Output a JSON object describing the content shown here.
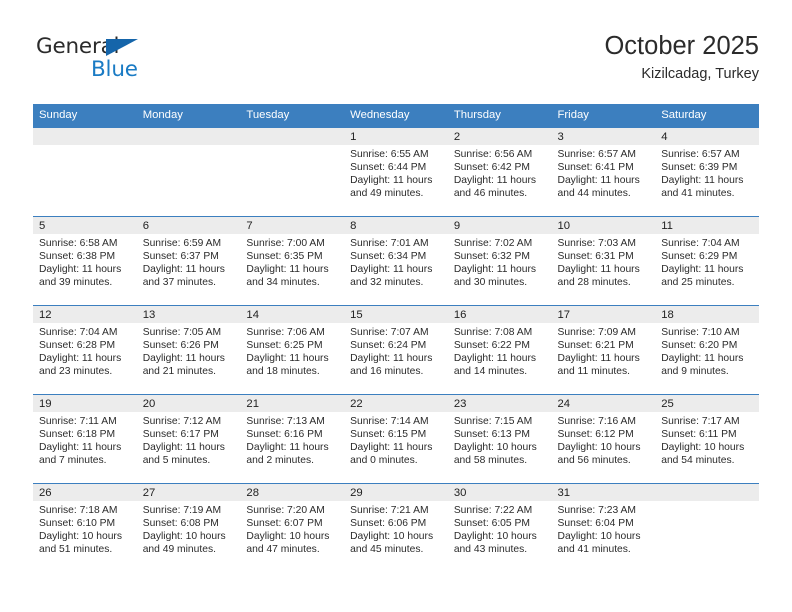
{
  "brand": {
    "name_part1": "General",
    "name_part2": "Blue",
    "logo_icon": "triangle-flag-icon"
  },
  "header": {
    "title": "October 2025",
    "subtitle": "Kizilcadag, Turkey"
  },
  "calendar": {
    "weekday_headers": [
      "Sunday",
      "Monday",
      "Tuesday",
      "Wednesday",
      "Thursday",
      "Friday",
      "Saturday"
    ],
    "accent_color": "#3c7fbf",
    "daynum_bar_color": "#ececec",
    "weeks": [
      [
        {
          "day": "",
          "sunrise": "",
          "sunset": "",
          "daylight_line1": "",
          "daylight_line2": ""
        },
        {
          "day": "",
          "sunrise": "",
          "sunset": "",
          "daylight_line1": "",
          "daylight_line2": ""
        },
        {
          "day": "",
          "sunrise": "",
          "sunset": "",
          "daylight_line1": "",
          "daylight_line2": ""
        },
        {
          "day": "1",
          "sunrise": "Sunrise: 6:55 AM",
          "sunset": "Sunset: 6:44 PM",
          "daylight_line1": "Daylight: 11 hours",
          "daylight_line2": "and 49 minutes."
        },
        {
          "day": "2",
          "sunrise": "Sunrise: 6:56 AM",
          "sunset": "Sunset: 6:42 PM",
          "daylight_line1": "Daylight: 11 hours",
          "daylight_line2": "and 46 minutes."
        },
        {
          "day": "3",
          "sunrise": "Sunrise: 6:57 AM",
          "sunset": "Sunset: 6:41 PM",
          "daylight_line1": "Daylight: 11 hours",
          "daylight_line2": "and 44 minutes."
        },
        {
          "day": "4",
          "sunrise": "Sunrise: 6:57 AM",
          "sunset": "Sunset: 6:39 PM",
          "daylight_line1": "Daylight: 11 hours",
          "daylight_line2": "and 41 minutes."
        }
      ],
      [
        {
          "day": "5",
          "sunrise": "Sunrise: 6:58 AM",
          "sunset": "Sunset: 6:38 PM",
          "daylight_line1": "Daylight: 11 hours",
          "daylight_line2": "and 39 minutes."
        },
        {
          "day": "6",
          "sunrise": "Sunrise: 6:59 AM",
          "sunset": "Sunset: 6:37 PM",
          "daylight_line1": "Daylight: 11 hours",
          "daylight_line2": "and 37 minutes."
        },
        {
          "day": "7",
          "sunrise": "Sunrise: 7:00 AM",
          "sunset": "Sunset: 6:35 PM",
          "daylight_line1": "Daylight: 11 hours",
          "daylight_line2": "and 34 minutes."
        },
        {
          "day": "8",
          "sunrise": "Sunrise: 7:01 AM",
          "sunset": "Sunset: 6:34 PM",
          "daylight_line1": "Daylight: 11 hours",
          "daylight_line2": "and 32 minutes."
        },
        {
          "day": "9",
          "sunrise": "Sunrise: 7:02 AM",
          "sunset": "Sunset: 6:32 PM",
          "daylight_line1": "Daylight: 11 hours",
          "daylight_line2": "and 30 minutes."
        },
        {
          "day": "10",
          "sunrise": "Sunrise: 7:03 AM",
          "sunset": "Sunset: 6:31 PM",
          "daylight_line1": "Daylight: 11 hours",
          "daylight_line2": "and 28 minutes."
        },
        {
          "day": "11",
          "sunrise": "Sunrise: 7:04 AM",
          "sunset": "Sunset: 6:29 PM",
          "daylight_line1": "Daylight: 11 hours",
          "daylight_line2": "and 25 minutes."
        }
      ],
      [
        {
          "day": "12",
          "sunrise": "Sunrise: 7:04 AM",
          "sunset": "Sunset: 6:28 PM",
          "daylight_line1": "Daylight: 11 hours",
          "daylight_line2": "and 23 minutes."
        },
        {
          "day": "13",
          "sunrise": "Sunrise: 7:05 AM",
          "sunset": "Sunset: 6:26 PM",
          "daylight_line1": "Daylight: 11 hours",
          "daylight_line2": "and 21 minutes."
        },
        {
          "day": "14",
          "sunrise": "Sunrise: 7:06 AM",
          "sunset": "Sunset: 6:25 PM",
          "daylight_line1": "Daylight: 11 hours",
          "daylight_line2": "and 18 minutes."
        },
        {
          "day": "15",
          "sunrise": "Sunrise: 7:07 AM",
          "sunset": "Sunset: 6:24 PM",
          "daylight_line1": "Daylight: 11 hours",
          "daylight_line2": "and 16 minutes."
        },
        {
          "day": "16",
          "sunrise": "Sunrise: 7:08 AM",
          "sunset": "Sunset: 6:22 PM",
          "daylight_line1": "Daylight: 11 hours",
          "daylight_line2": "and 14 minutes."
        },
        {
          "day": "17",
          "sunrise": "Sunrise: 7:09 AM",
          "sunset": "Sunset: 6:21 PM",
          "daylight_line1": "Daylight: 11 hours",
          "daylight_line2": "and 11 minutes."
        },
        {
          "day": "18",
          "sunrise": "Sunrise: 7:10 AM",
          "sunset": "Sunset: 6:20 PM",
          "daylight_line1": "Daylight: 11 hours",
          "daylight_line2": "and 9 minutes."
        }
      ],
      [
        {
          "day": "19",
          "sunrise": "Sunrise: 7:11 AM",
          "sunset": "Sunset: 6:18 PM",
          "daylight_line1": "Daylight: 11 hours",
          "daylight_line2": "and 7 minutes."
        },
        {
          "day": "20",
          "sunrise": "Sunrise: 7:12 AM",
          "sunset": "Sunset: 6:17 PM",
          "daylight_line1": "Daylight: 11 hours",
          "daylight_line2": "and 5 minutes."
        },
        {
          "day": "21",
          "sunrise": "Sunrise: 7:13 AM",
          "sunset": "Sunset: 6:16 PM",
          "daylight_line1": "Daylight: 11 hours",
          "daylight_line2": "and 2 minutes."
        },
        {
          "day": "22",
          "sunrise": "Sunrise: 7:14 AM",
          "sunset": "Sunset: 6:15 PM",
          "daylight_line1": "Daylight: 11 hours",
          "daylight_line2": "and 0 minutes."
        },
        {
          "day": "23",
          "sunrise": "Sunrise: 7:15 AM",
          "sunset": "Sunset: 6:13 PM",
          "daylight_line1": "Daylight: 10 hours",
          "daylight_line2": "and 58 minutes."
        },
        {
          "day": "24",
          "sunrise": "Sunrise: 7:16 AM",
          "sunset": "Sunset: 6:12 PM",
          "daylight_line1": "Daylight: 10 hours",
          "daylight_line2": "and 56 minutes."
        },
        {
          "day": "25",
          "sunrise": "Sunrise: 7:17 AM",
          "sunset": "Sunset: 6:11 PM",
          "daylight_line1": "Daylight: 10 hours",
          "daylight_line2": "and 54 minutes."
        }
      ],
      [
        {
          "day": "26",
          "sunrise": "Sunrise: 7:18 AM",
          "sunset": "Sunset: 6:10 PM",
          "daylight_line1": "Daylight: 10 hours",
          "daylight_line2": "and 51 minutes."
        },
        {
          "day": "27",
          "sunrise": "Sunrise: 7:19 AM",
          "sunset": "Sunset: 6:08 PM",
          "daylight_line1": "Daylight: 10 hours",
          "daylight_line2": "and 49 minutes."
        },
        {
          "day": "28",
          "sunrise": "Sunrise: 7:20 AM",
          "sunset": "Sunset: 6:07 PM",
          "daylight_line1": "Daylight: 10 hours",
          "daylight_line2": "and 47 minutes."
        },
        {
          "day": "29",
          "sunrise": "Sunrise: 7:21 AM",
          "sunset": "Sunset: 6:06 PM",
          "daylight_line1": "Daylight: 10 hours",
          "daylight_line2": "and 45 minutes."
        },
        {
          "day": "30",
          "sunrise": "Sunrise: 7:22 AM",
          "sunset": "Sunset: 6:05 PM",
          "daylight_line1": "Daylight: 10 hours",
          "daylight_line2": "and 43 minutes."
        },
        {
          "day": "31",
          "sunrise": "Sunrise: 7:23 AM",
          "sunset": "Sunset: 6:04 PM",
          "daylight_line1": "Daylight: 10 hours",
          "daylight_line2": "and 41 minutes."
        },
        {
          "day": "",
          "sunrise": "",
          "sunset": "",
          "daylight_line1": "",
          "daylight_line2": ""
        }
      ]
    ]
  }
}
